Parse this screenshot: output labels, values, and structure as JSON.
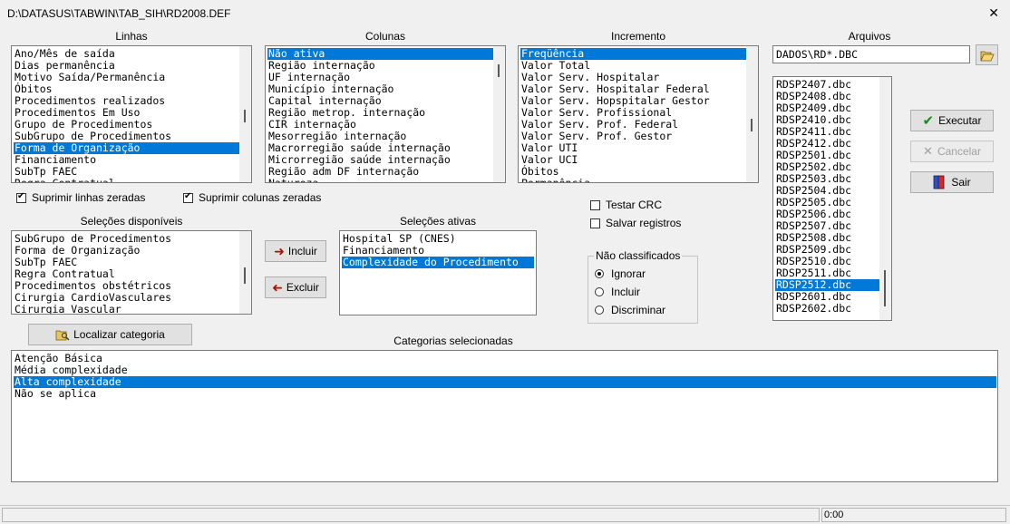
{
  "window": {
    "title": "D:\\DATASUS\\TABWIN\\TAB_SIH\\RD2008.DEF",
    "close_symbol": "✕"
  },
  "linhas": {
    "header": "Linhas",
    "selected_index": 8,
    "items": [
      "Ano/Mês de saída",
      "Dias permanência",
      "Motivo Saída/Permanência",
      "Óbitos",
      "Procedimentos realizados",
      "Procedimentos Em Uso",
      "Grupo de Procedimentos",
      "SubGrupo de Procedimentos",
      "Forma de Organização",
      "Financiamento",
      "SubTp FAEC",
      "Regra Contratual"
    ]
  },
  "colunas": {
    "header": "Colunas",
    "selected_index": 0,
    "items": [
      "Não ativa",
      "Região internação",
      "UF internação",
      "Município internação",
      "Capital internação",
      "Região metrop. internação",
      "CIR internação",
      "Mesorregião internação",
      "Macrorregião saúde internação",
      "Microrregião saúde internação",
      "Região adm DF internação",
      "Natureza"
    ]
  },
  "incremento": {
    "header": "Incremento",
    "selected_index": 0,
    "items": [
      "Freqüência",
      "Valor Total",
      "Valor Serv. Hospitalar",
      "Valor Serv. Hospitalar Federal",
      "Valor Serv. Hopspitalar Gestor",
      "Valor Serv. Profissional",
      "Valor Serv. Prof. Federal",
      "Valor Serv. Prof. Gestor",
      "Valor UTI",
      "Valor UCI",
      "Óbitos",
      "Permanência"
    ]
  },
  "arquivos": {
    "header": "Arquivos",
    "pattern": "DADOS\\RD*.DBC",
    "folder_icon": "folder-open-icon",
    "selected_index": 17,
    "items": [
      "RDSP2407.dbc",
      "RDSP2408.dbc",
      "RDSP2409.dbc",
      "RDSP2410.dbc",
      "RDSP2411.dbc",
      "RDSP2412.dbc",
      "RDSP2501.dbc",
      "RDSP2502.dbc",
      "RDSP2503.dbc",
      "RDSP2504.dbc",
      "RDSP2505.dbc",
      "RDSP2506.dbc",
      "RDSP2507.dbc",
      "RDSP2508.dbc",
      "RDSP2509.dbc",
      "RDSP2510.dbc",
      "RDSP2511.dbc",
      "RDSP2512.dbc",
      "RDSP2601.dbc",
      "RDSP2602.dbc"
    ]
  },
  "buttons": {
    "executar": "Executar",
    "cancelar": "Cancelar",
    "sair": "Sair",
    "incluir": "Incluir",
    "excluir": "Excluir",
    "localizar": "Localizar categoria"
  },
  "checks": {
    "suprimir_linhas": "Suprimir linhas zeradas",
    "suprimir_colunas": "Suprimir colunas zeradas",
    "testar_crc": "Testar CRC",
    "salvar_registros": "Salvar registros"
  },
  "nao_classificados": {
    "legend": "Não classificados",
    "options": [
      "Ignorar",
      "Incluir",
      "Discriminar"
    ],
    "selected": 0
  },
  "selecoes_disponiveis": {
    "header": "Seleções disponíveis",
    "items": [
      "SubGrupo de Procedimentos",
      "Forma de Organização",
      "SubTp FAEC",
      "Regra Contratual",
      "Procedimentos obstétricos",
      "Cirurgia CardioVasculares",
      "Cirurgia Vascular"
    ]
  },
  "selecoes_ativas": {
    "header": "Seleções ativas",
    "selected_index": 2,
    "items": [
      "Hospital SP (CNES)",
      "Financiamento",
      "Complexidade do Procedimento"
    ]
  },
  "categorias": {
    "header": "Categorias selecionadas",
    "selected_index": 2,
    "items": [
      "Atenção Básica",
      "Média complexidade",
      "Alta complexidade",
      "Não se aplica"
    ]
  },
  "status": {
    "time": "0:00"
  },
  "colors": {
    "selection": "#0078d7"
  }
}
